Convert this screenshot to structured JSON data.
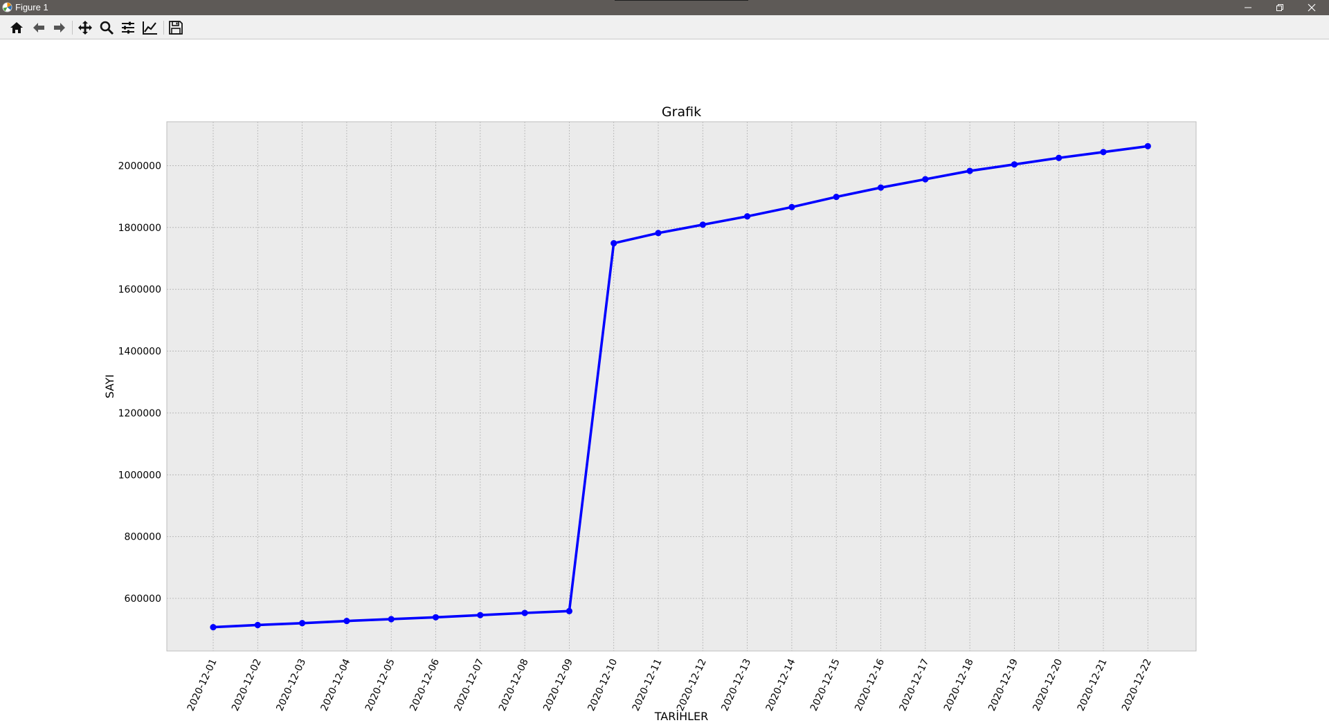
{
  "window": {
    "title": "Figure 1",
    "controls": [
      "minimize",
      "restore",
      "close"
    ]
  },
  "toolbar": {
    "buttons": [
      {
        "name": "home-icon",
        "tooltip": ""
      },
      {
        "name": "back-arrow-icon",
        "tooltip": ""
      },
      {
        "name": "forward-arrow-icon",
        "tooltip": ""
      },
      {
        "name": "pan-icon",
        "tooltip": ""
      },
      {
        "name": "zoom-icon",
        "tooltip": ""
      },
      {
        "name": "subplots-icon",
        "tooltip": ""
      },
      {
        "name": "edit-axis-icon",
        "tooltip": ""
      },
      {
        "name": "save-icon",
        "tooltip": ""
      }
    ]
  },
  "colors": {
    "line": "#0000ff",
    "plot_bg": "#ebebeb",
    "grid": "#b0b0b0",
    "titlebar": "#5e5a57",
    "toolbar": "#f0f0f0"
  },
  "chart_data": {
    "type": "line",
    "title": "Grafik",
    "xlabel": "TARİHLER",
    "ylabel": "SAYI",
    "x": [
      "2020-12-01",
      "2020-12-02",
      "2020-12-03",
      "2020-12-04",
      "2020-12-05",
      "2020-12-06",
      "2020-12-07",
      "2020-12-08",
      "2020-12-09",
      "2020-12-10",
      "2020-12-11",
      "2020-12-12",
      "2020-12-13",
      "2020-12-14",
      "2020-12-15",
      "2020-12-16",
      "2020-12-17",
      "2020-12-18",
      "2020-12-19",
      "2020-12-20",
      "2020-12-21",
      "2020-12-22"
    ],
    "series": [
      {
        "values": [
          507000,
          514000,
          520000,
          527000,
          533000,
          539000,
          546000,
          553000,
          559000,
          1749000,
          1782000,
          1809000,
          1836000,
          1866000,
          1899000,
          1929000,
          1956000,
          1983000,
          2004000,
          2025000,
          2044000,
          2063000
        ],
        "color": "#0000ff",
        "marker": "circle"
      }
    ],
    "yticks": [
      600000,
      800000,
      1000000,
      1200000,
      1400000,
      1600000,
      1800000,
      2000000
    ],
    "ylim": [
      430000,
      2142000
    ],
    "grid": true,
    "legend": "none"
  }
}
